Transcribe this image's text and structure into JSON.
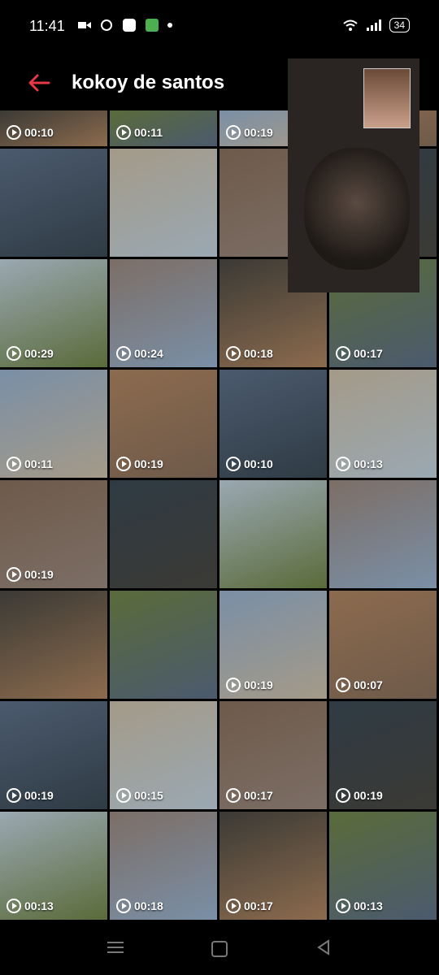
{
  "status": {
    "time": "11:41",
    "battery": "34"
  },
  "header": {
    "title": "kokoy de santos"
  },
  "colors": {
    "accent": "#e53945"
  },
  "rows": [
    [
      {
        "d": "00:10"
      },
      {
        "d": "00:11"
      },
      {
        "d": "00:19"
      },
      {
        "d": ""
      }
    ],
    [
      {
        "d": ""
      },
      {
        "d": ""
      },
      {
        "d": ""
      },
      {
        "d": ""
      }
    ],
    [
      {
        "d": "00:29"
      },
      {
        "d": "00:24"
      },
      {
        "d": "00:18"
      },
      {
        "d": "00:17"
      }
    ],
    [
      {
        "d": "00:11"
      },
      {
        "d": "00:19"
      },
      {
        "d": "00:10"
      },
      {
        "d": "00:13"
      }
    ],
    [
      {
        "d": "00:19"
      },
      {
        "d": ""
      },
      {
        "d": ""
      },
      {
        "d": ""
      }
    ],
    [
      {
        "d": ""
      },
      {
        "d": ""
      },
      {
        "d": "00:19"
      },
      {
        "d": "00:07"
      }
    ],
    [
      {
        "d": "00:19"
      },
      {
        "d": "00:15"
      },
      {
        "d": "00:17"
      },
      {
        "d": "00:19"
      }
    ],
    [
      {
        "d": "00:13"
      },
      {
        "d": "00:18"
      },
      {
        "d": "00:17"
      },
      {
        "d": "00:13"
      }
    ]
  ],
  "icons": {
    "back": "back-arrow-icon"
  }
}
